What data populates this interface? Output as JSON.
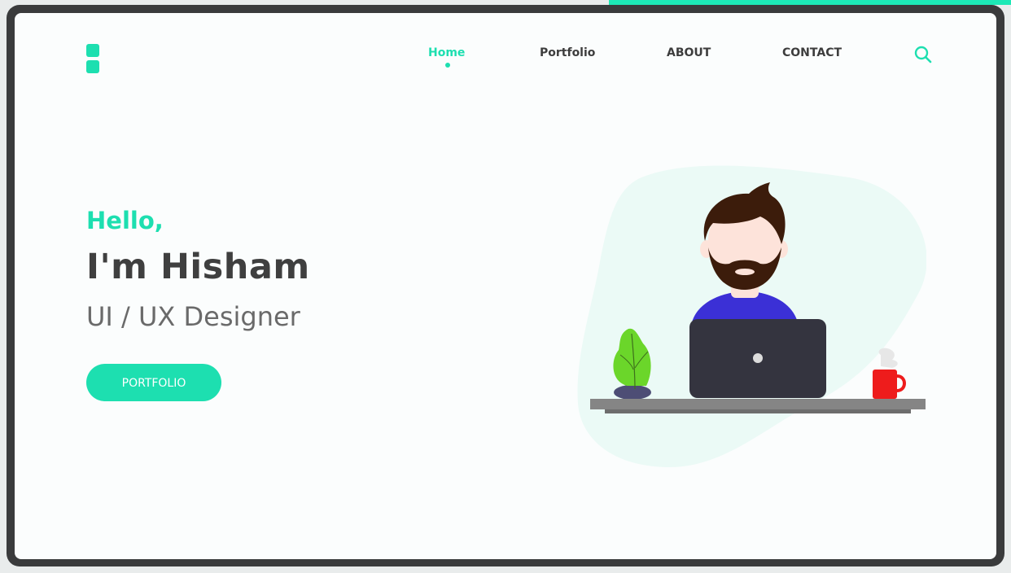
{
  "nav": {
    "items": [
      {
        "label": "Home",
        "active": true
      },
      {
        "label": "Portfolio",
        "active": false
      },
      {
        "label": "ABOUT",
        "active": false
      },
      {
        "label": "CONTACT",
        "active": false
      }
    ],
    "search_icon": "search-icon"
  },
  "hero": {
    "greeting": "Hello,",
    "name": "I'm Hisham",
    "role": "UI / UX Designer",
    "button_label": "PORTFOLIO"
  },
  "colors": {
    "accent": "#1ddfb0",
    "frame": "#3a3b3c",
    "heading": "#3f3f3f",
    "subheading": "#6a6a6a",
    "shirt": "#3b30d6",
    "laptop": "#34343f",
    "plant": "#6bd62a",
    "mug": "#ee1c1c",
    "desk": "#858585"
  }
}
